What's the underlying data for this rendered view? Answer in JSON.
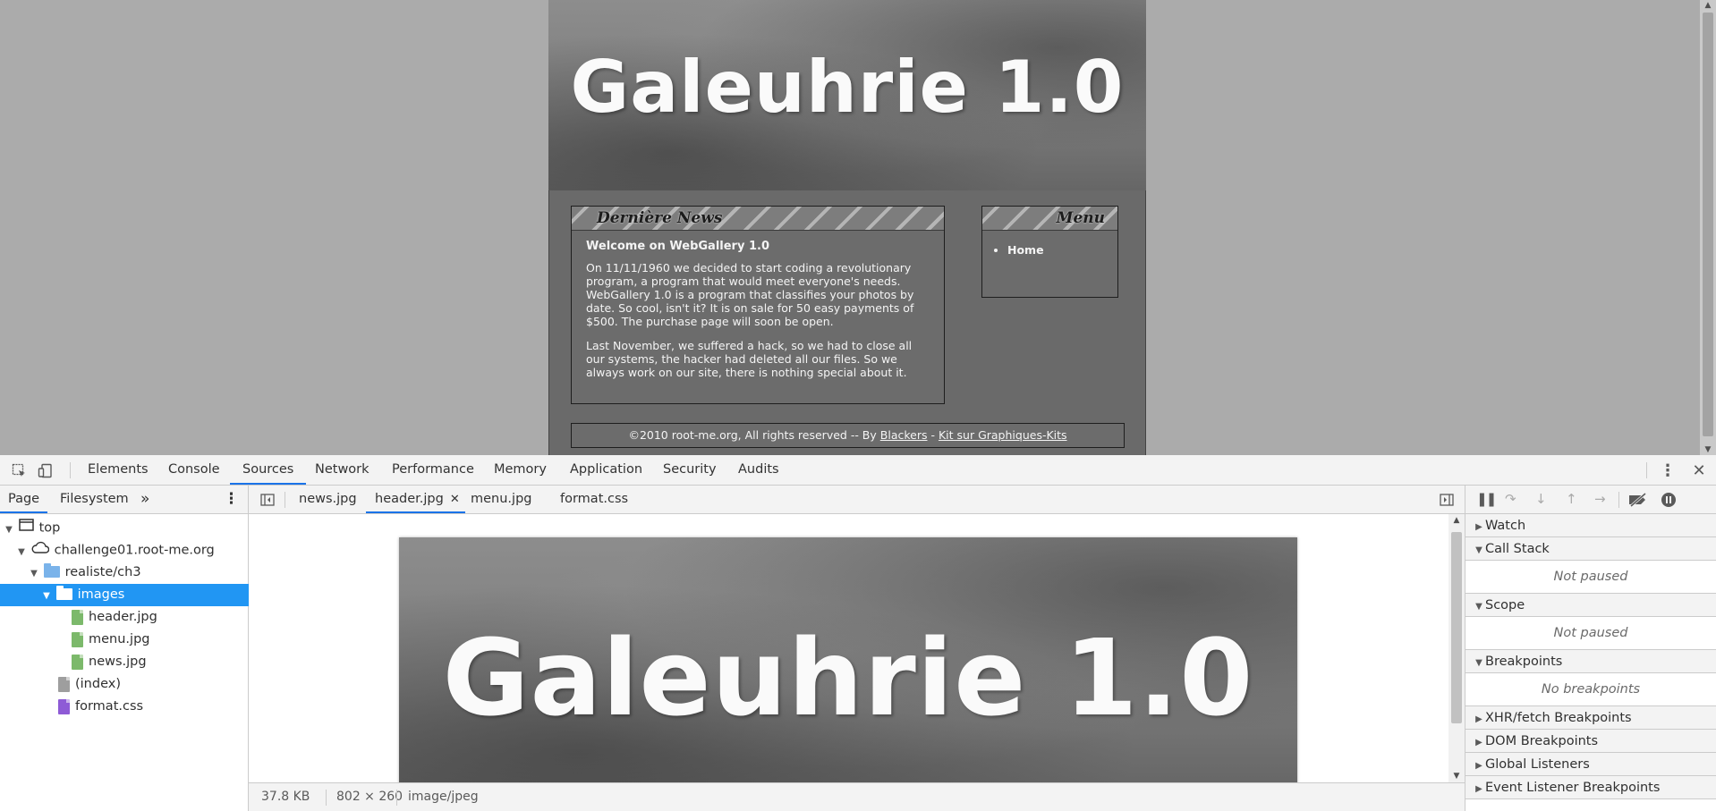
{
  "page": {
    "header_title": "Galeuhrie 1.0",
    "news": {
      "heading": "Dernière News",
      "title": "Welcome on WebGallery 1.0",
      "paragraph1": "On 11/11/1960 we decided to start coding a revolutionary program, a program that would meet everyone's needs. WebGallery 1.0 is a program that classifies your photos by date. So cool, isn't it? It is on sale for 50 easy payments of $500. The purchase page will soon be open.",
      "paragraph2": "Last November, we suffered a hack, so we had to close all our systems, the hacker had deleted all our files. So we always work on our site, there is nothing special about it."
    },
    "menu": {
      "heading": "Menu",
      "items": [
        "Home"
      ]
    },
    "footer": {
      "text": "©2010 root-me.org, All rights reserved -- By",
      "link1": "Blackers",
      "separator": "-",
      "link2": "Kit sur Graphiques-Kits"
    }
  },
  "devtools": {
    "tabs": [
      "Elements",
      "Console",
      "Sources",
      "Network",
      "Performance",
      "Memory",
      "Application",
      "Security",
      "Audits"
    ],
    "active_tab": "Sources",
    "navigator": {
      "tabs": [
        "Page",
        "Filesystem"
      ],
      "more_label": "»",
      "tree": {
        "top": "top",
        "domain": "challenge01.root-me.org",
        "folder": "realiste/ch3",
        "images_folder": "images",
        "files_in_images": [
          "header.jpg",
          "menu.jpg",
          "news.jpg"
        ],
        "index": "(index)",
        "css": "format.css"
      }
    },
    "editor": {
      "tabs": [
        "news.jpg",
        "header.jpg",
        "menu.jpg",
        "format.css"
      ],
      "active_tab": "header.jpg",
      "preview_title": "Galeuhrie 1.0",
      "status": {
        "size": "37.8 KB",
        "dimensions": "802 × 260",
        "mime": "image/jpeg"
      }
    },
    "debugger": {
      "panes": {
        "watch": "Watch",
        "call_stack": "Call Stack",
        "call_stack_empty": "Not paused",
        "scope": "Scope",
        "scope_empty": "Not paused",
        "breakpoints": "Breakpoints",
        "breakpoints_empty": "No breakpoints",
        "xhr": "XHR/fetch Breakpoints",
        "dom": "DOM Breakpoints",
        "global": "Global Listeners",
        "event": "Event Listener Breakpoints"
      }
    },
    "colors": {
      "accent": "#1a73e8",
      "selection": "#2196f3",
      "image_file": "#7cb96b",
      "index_file": "#9e9e9e",
      "css_file": "#8e5bd6"
    }
  }
}
